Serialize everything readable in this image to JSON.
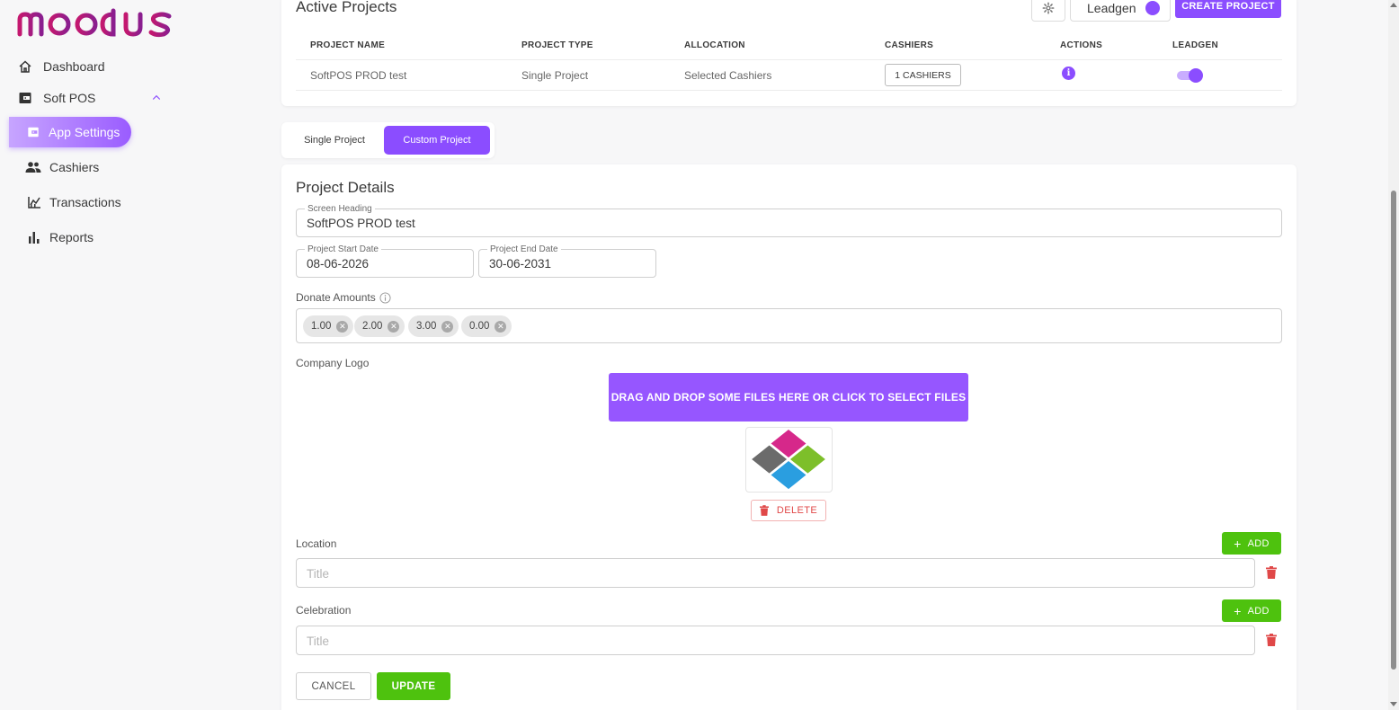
{
  "brand": {
    "name": "MOODUS"
  },
  "sidebar": {
    "dashboard": "Dashboard",
    "soft_pos": "Soft POS",
    "app_settings": "App Settings",
    "cashiers": "Cashiers",
    "transactions": "Transactions",
    "reports": "Reports"
  },
  "active_projects": {
    "title": "Active Projects",
    "leadgen_label": "Leadgen",
    "leadgen_on": true,
    "create_label": "CREATE PROJECT",
    "columns": [
      "PROJECT NAME",
      "PROJECT TYPE",
      "ALLOCATION",
      "CASHIERS",
      "ACTIONS",
      "LEADGEN"
    ],
    "rows": [
      {
        "name": "SoftPOS PROD test",
        "type": "Single Project",
        "allocation": "Selected Cashiers",
        "cashiers": "1 CASHIERS",
        "leadgen_on": true
      }
    ]
  },
  "tabs": {
    "single": "Single Project",
    "custom": "Custom Project",
    "active": "custom"
  },
  "details": {
    "title": "Project Details",
    "screen_heading_label": "Screen Heading",
    "screen_heading_value": "SoftPOS PROD test",
    "start_label": "Project Start Date",
    "start_value": "08-06-2026",
    "end_label": "Project End Date",
    "end_value": "30-06-2031",
    "donate_label": "Donate Amounts",
    "donate_amounts": [
      "1.00",
      "2.00",
      "3.00",
      "0.00"
    ],
    "logo_label": "Company Logo",
    "dropzone": "DRAG AND DROP SOME FILES HERE OR CLICK TO SELECT FILES",
    "delete_label": "DELETE",
    "location_label": "Location",
    "location_placeholder": "Title",
    "celebration_label": "Celebration",
    "celebration_placeholder": "Title",
    "add_label": "ADD",
    "cancel_label": "CANCEL",
    "update_label": "UPDATE"
  },
  "colors": {
    "accent": "#8b4dff",
    "success": "#4ec20e",
    "danger": "#e04848"
  }
}
